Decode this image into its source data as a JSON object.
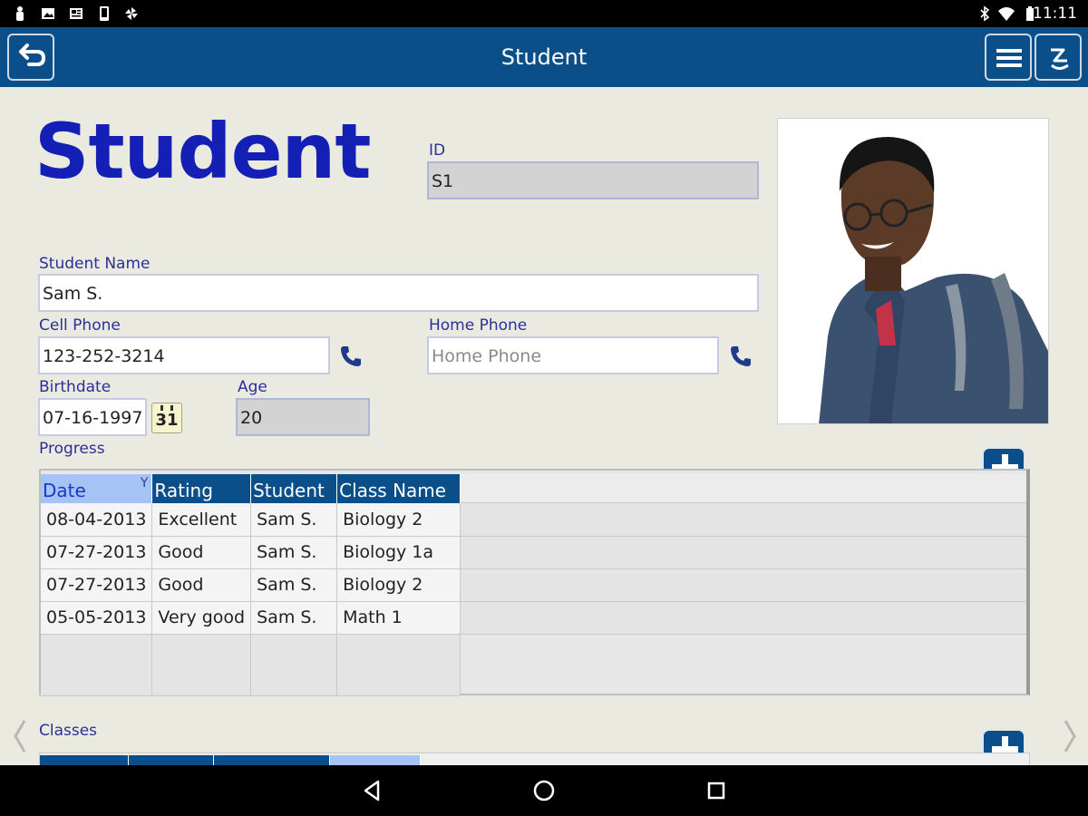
{
  "status_bar": {
    "time": "11:11",
    "left_icons": [
      "person-icon",
      "image-icon",
      "newspaper-icon",
      "phone-device-icon",
      "pinwheel-icon"
    ],
    "right_icons": [
      "bluetooth-icon",
      "wifi-icon",
      "battery-icon"
    ]
  },
  "app_bar": {
    "title": "Student",
    "back_icon": "undo-arrow-icon",
    "menu_icon": "hamburger-menu-icon",
    "signature_icon": "signature-icon"
  },
  "form": {
    "heading": "Student",
    "id_label": "ID",
    "id_value": "S1",
    "name_label": "Student Name",
    "name_value": "Sam S.",
    "cell_label": "Cell Phone",
    "cell_value": "123-252-3214",
    "home_label": "Home Phone",
    "home_placeholder": "Home Phone",
    "birthdate_label": "Birthdate",
    "birthdate_value": "07-16-1997",
    "calendar_day": "31",
    "age_label": "Age",
    "age_value": "20",
    "photo": "student-photo"
  },
  "progress": {
    "label": "Progress",
    "columns": [
      "Date",
      "Rating",
      "Student",
      "Class Name"
    ],
    "rows": [
      [
        "08-04-2013",
        "Excellent",
        "Sam S.",
        "Biology 2"
      ],
      [
        "07-27-2013",
        "Good",
        "Sam S.",
        "Biology 1a"
      ],
      [
        "07-27-2013",
        "Good",
        "Sam S.",
        "Biology 2"
      ],
      [
        "05-05-2013",
        "Very good",
        "Sam S.",
        "Math 1"
      ]
    ]
  },
  "classes": {
    "label": "Classes"
  },
  "colors": {
    "app_bar": "#0b4f8a",
    "heading": "#1420b5",
    "label": "#2a2f9a",
    "background": "#ebeae0"
  }
}
